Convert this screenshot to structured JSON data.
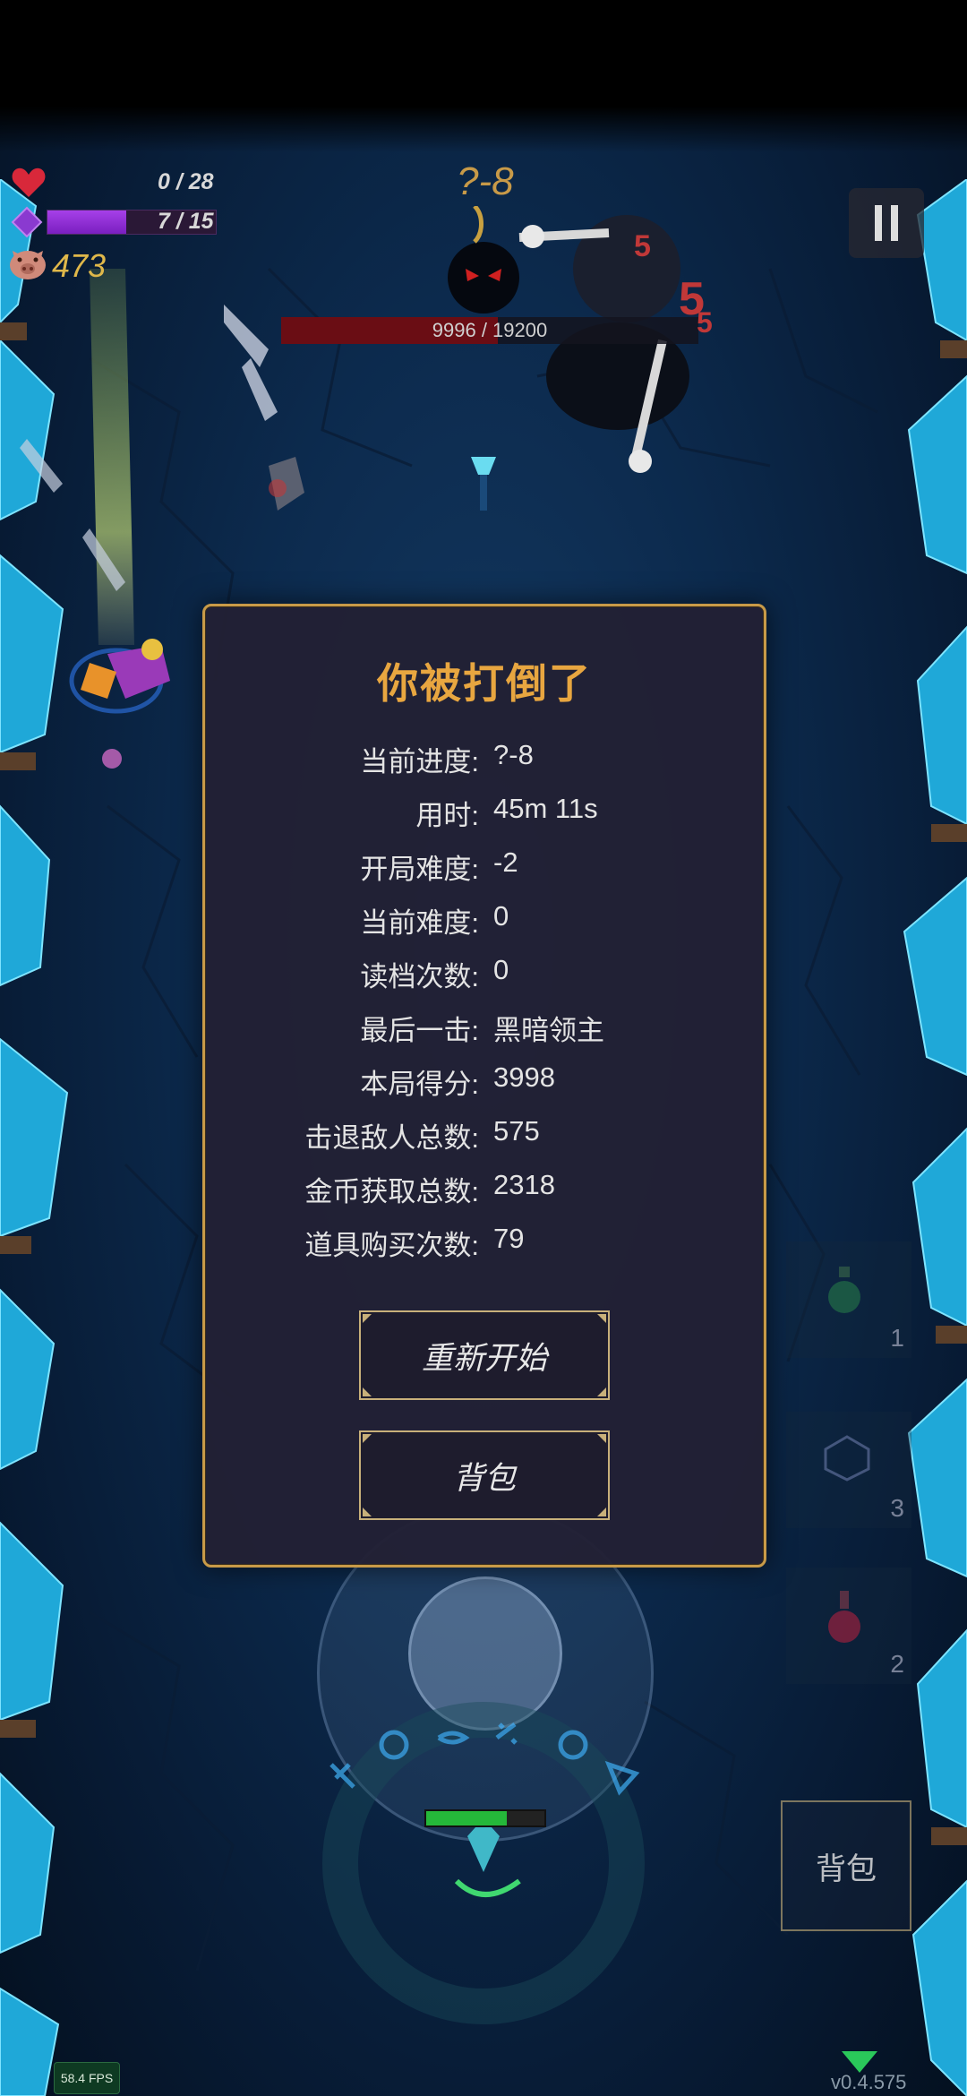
{
  "hud": {
    "hp": "0 / 28",
    "mana": "7 / 15",
    "mana_fraction": 0.47,
    "coins": "473",
    "level": "?-8"
  },
  "boss": {
    "hp_text": "9996 / 19200",
    "hp_fraction": 0.52
  },
  "damage_numbers": [
    "5",
    "5",
    "5"
  ],
  "dialog": {
    "title": "你被打倒了",
    "stats": [
      {
        "label": "当前进度:",
        "value": "?-8"
      },
      {
        "label": "用时:",
        "value": "45m 11s"
      },
      {
        "label": "开局难度:",
        "value": "-2"
      },
      {
        "label": "当前难度:",
        "value": "0"
      },
      {
        "label": "读档次数:",
        "value": "0"
      },
      {
        "label": "最后一击:",
        "value": "黑暗领主"
      },
      {
        "label": "本局得分:",
        "value": "3998"
      },
      {
        "label": "击退敌人总数:",
        "value": "575"
      },
      {
        "label": "金币获取总数:",
        "value": "2318"
      },
      {
        "label": "道具购买次数:",
        "value": "79"
      }
    ],
    "restart_label": "重新开始",
    "bag_label": "背包"
  },
  "item_slots": [
    {
      "count": "1",
      "icon": "potion-green-icon"
    },
    {
      "count": "3",
      "icon": "dice-icon"
    },
    {
      "count": "2",
      "icon": "potion-red-icon"
    }
  ],
  "bag_button_label": "背包",
  "fps": "58.4 FPS",
  "version": "v0.4.575",
  "colors": {
    "accent_gold": "#c89a48",
    "title_orange": "#e8a640",
    "mana_purple": "#a640e8",
    "hp_red": "#d8283a"
  }
}
